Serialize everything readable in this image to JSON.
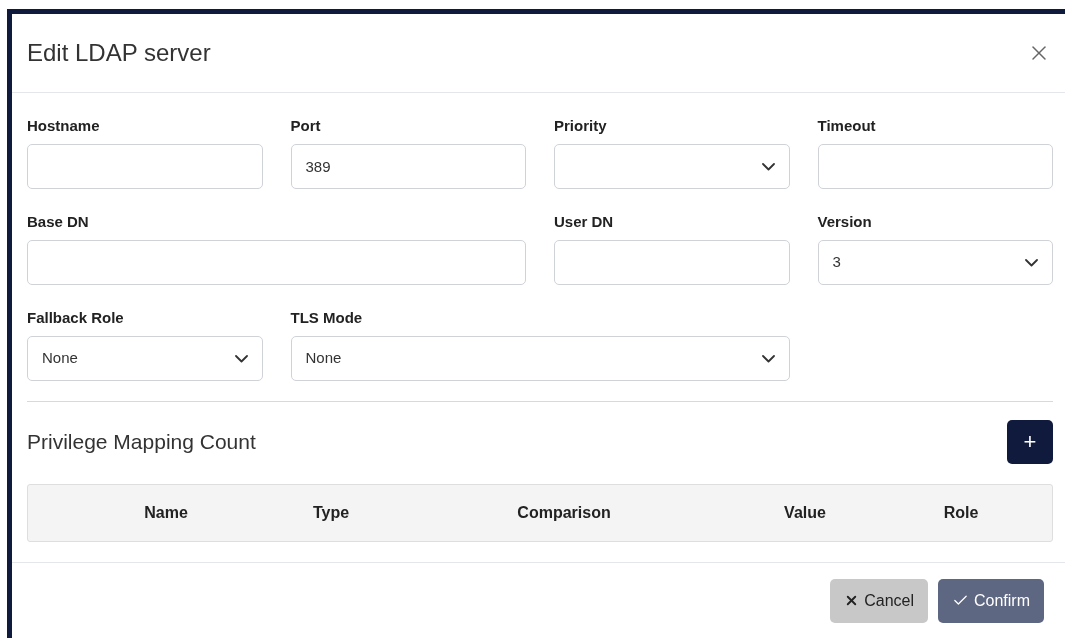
{
  "dialog": {
    "title": "Edit LDAP server"
  },
  "fields": [
    {
      "label": "Hostname",
      "kind": "text"
    },
    {
      "label": "Port",
      "kind": "text",
      "value": "389"
    },
    {
      "label": "Priority",
      "kind": "select"
    },
    {
      "label": "Timeout",
      "kind": "text"
    },
    {
      "label": "Base DN",
      "kind": "text"
    },
    {
      "label": "User DN",
      "kind": "text"
    },
    {
      "label": "Version",
      "kind": "select",
      "value": "3"
    },
    {
      "label": "Fallback Role",
      "kind": "select",
      "value": "None"
    },
    {
      "label": "TLS Mode",
      "kind": "select",
      "value": "None"
    }
  ],
  "mapping": {
    "title": "Privilege Mapping Count",
    "add": "+",
    "columns": [
      "Name",
      "Type",
      "Comparison",
      "Value",
      "Role"
    ]
  },
  "buttons": [
    {
      "label": "Cancel",
      "kind": "cancel"
    },
    {
      "label": "Confirm",
      "kind": "confirm"
    }
  ]
}
